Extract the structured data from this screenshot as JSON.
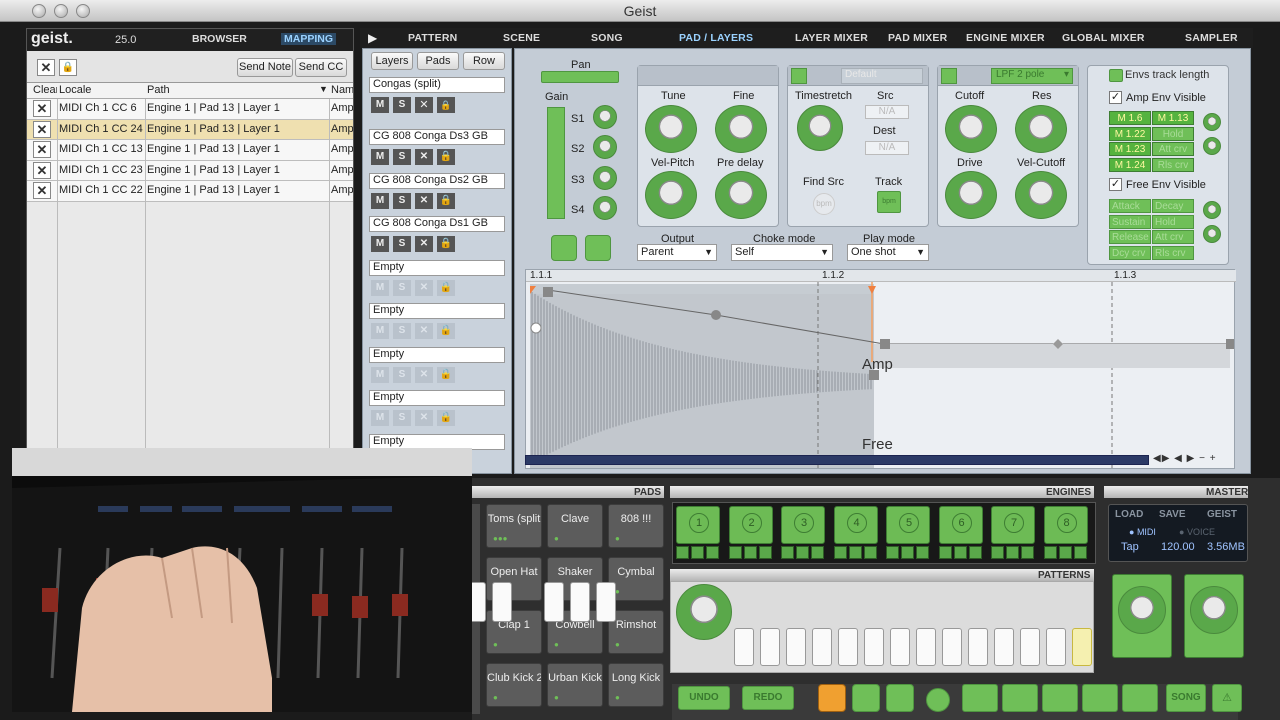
{
  "app": {
    "title": "Geist"
  },
  "mapping_panel": {
    "logo": "geist.",
    "version": "25.0",
    "tabs": [
      {
        "label": "BROWSER"
      },
      {
        "label": "MAPPING"
      }
    ],
    "send_note": "Send Note",
    "send_cc": "Send CC",
    "columns": [
      "Clear",
      "Locale",
      "Path",
      "Name"
    ],
    "rows": [
      {
        "locale": "MIDI Ch 1 CC 6",
        "path": "Engine 1 | Pad 13 | Layer 1",
        "name": "Amp"
      },
      {
        "locale": "MIDI Ch 1 CC 24",
        "path": "Engine 1 | Pad 13 | Layer 1",
        "name": "Amp"
      },
      {
        "locale": "MIDI Ch 1 CC 13",
        "path": "Engine 1 | Pad 13 | Layer 1",
        "name": "Amp"
      },
      {
        "locale": "MIDI Ch 1 CC 23",
        "path": "Engine 1 | Pad 13 | Layer 1",
        "name": "Amp"
      },
      {
        "locale": "MIDI Ch 1 CC 22",
        "path": "Engine 1 | Pad 13 | Layer 1",
        "name": "Amp"
      }
    ]
  },
  "top_nav": {
    "tabs": [
      {
        "label": "PATTERN"
      },
      {
        "label": "SCENE"
      },
      {
        "label": "SONG"
      },
      {
        "label": "PAD / LAYERS"
      },
      {
        "label": "LAYER MIXER"
      },
      {
        "label": "PAD MIXER"
      },
      {
        "label": "ENGINE MIXER"
      },
      {
        "label": "GLOBAL MIXER"
      },
      {
        "label": "SAMPLER"
      }
    ]
  },
  "layers": {
    "subtabs": [
      {
        "label": "Layers"
      },
      {
        "label": "Pads"
      },
      {
        "label": "Row"
      }
    ],
    "header": "Congas (split)",
    "items": [
      {
        "name": "CG 808 Conga Ds3 GB"
      },
      {
        "name": "CG 808 Conga Ds2 GB"
      },
      {
        "name": "CG 808 Conga Ds1 GB"
      },
      {
        "name": "Empty"
      },
      {
        "name": "Empty"
      },
      {
        "name": "Empty"
      },
      {
        "name": "Empty"
      },
      {
        "name": "Empty"
      }
    ],
    "btn_m": "M",
    "btn_s": "S"
  },
  "editor": {
    "pan": "Pan",
    "gain": "Gain",
    "sends": [
      "S1",
      "S2",
      "S3",
      "S4"
    ],
    "tune": "Tune",
    "fine": "Fine",
    "vel_pitch": "Vel-Pitch",
    "pre_delay": "Pre delay",
    "timestretch": "Timestretch",
    "src": "Src",
    "src_val": "N/A",
    "dest": "Dest",
    "dest_val": "N/A",
    "find_src": "Find Src",
    "track": "Track",
    "bpm": "bpm",
    "filter_type": "LPF 2 pole",
    "stretch_mode": "Default",
    "cutoff": "Cutoff",
    "res": "Res",
    "drive": "Drive",
    "vel_cutoff": "Vel-Cutoff",
    "output_label": "Output",
    "output_value": "Parent",
    "choke_label": "Choke mode",
    "choke_value": "Self",
    "play_label": "Play mode",
    "play_value": "One shot",
    "envs_track": "Envs track length",
    "amp_env_visible": "Amp Env Visible",
    "amp_macros": [
      "M 1.6",
      "M 1.13",
      "M 1.22",
      "Hold",
      "M 1.23",
      "Att crv",
      "M 1.24",
      "Rls crv"
    ],
    "free_env_visible": "Free Env Visible",
    "free_params": [
      "Attack",
      "Decay",
      "Sustain",
      "Hold",
      "Release",
      "Att crv",
      "Dcy crv",
      "Rls crv"
    ]
  },
  "timeline": {
    "markers": [
      "1.1.1",
      "1.1.2",
      "1.1.3"
    ],
    "amp_label": "Amp",
    "free_label": "Free"
  },
  "bottom": {
    "pads_title": "PADS",
    "engines_title": "ENGINES",
    "master_title": "MASTER",
    "patterns_title": "PATTERNS",
    "pads": [
      "Toms (split",
      "Clave",
      "808 !!!",
      "Open Hat",
      "Shaker",
      "Cymbal",
      "Clap 1",
      "Cowbell",
      "Rimshot",
      "Club Kick 2",
      "Urban Kick",
      "Long Kick"
    ],
    "engines": [
      "1",
      "2",
      "3",
      "4",
      "5",
      "6",
      "7",
      "8"
    ],
    "master": {
      "load": "LOAD",
      "save": "SAVE",
      "geist": "GEIST",
      "midi": "MIDI",
      "voice": "VOICE",
      "tap": "Tap",
      "bpm": "120.00",
      "mem": "3.56MB"
    },
    "undo": "UNDO",
    "redo": "REDO",
    "song": "SONG"
  },
  "colors": {
    "accent_green": "#6fbf58",
    "highlight_row": "#efe0b0",
    "nav_active": "#9ad2ff"
  }
}
